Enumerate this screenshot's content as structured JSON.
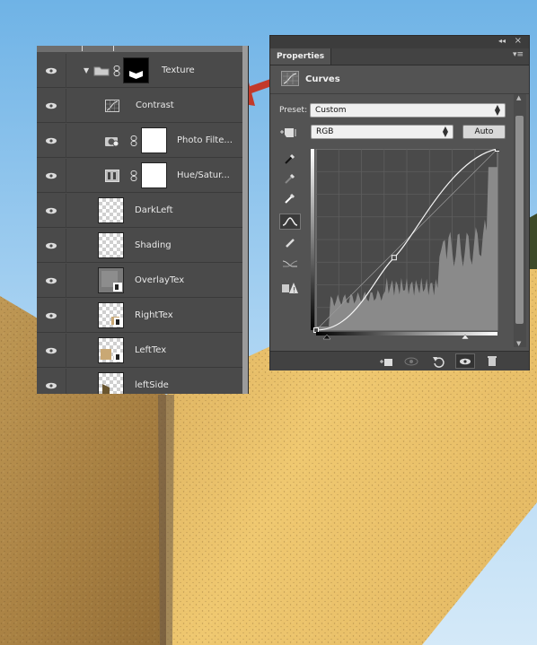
{
  "layers": [
    {
      "name": "Texture",
      "type": "group"
    },
    {
      "name": "Contrast",
      "type": "curves"
    },
    {
      "name": "Photo Filte...",
      "type": "photofilter"
    },
    {
      "name": "Hue/Satur...",
      "type": "huesat"
    },
    {
      "name": "DarkLeft",
      "type": "layer"
    },
    {
      "name": "Shading",
      "type": "layer"
    },
    {
      "name": "OverlayTex",
      "type": "layer"
    },
    {
      "name": "RightTex",
      "type": "layer"
    },
    {
      "name": "LeftTex",
      "type": "layer"
    },
    {
      "name": "leftSide",
      "type": "layer"
    }
  ],
  "properties": {
    "tab": "Properties",
    "title": "Curves",
    "preset_label": "Preset:",
    "preset_value": "Custom",
    "channel_value": "RGB",
    "auto_label": "Auto"
  },
  "curve": {
    "points": [
      [
        0,
        0
      ],
      [
        0.43,
        0.4
      ],
      [
        1,
        1
      ]
    ],
    "bar_color": "#c0392b"
  }
}
